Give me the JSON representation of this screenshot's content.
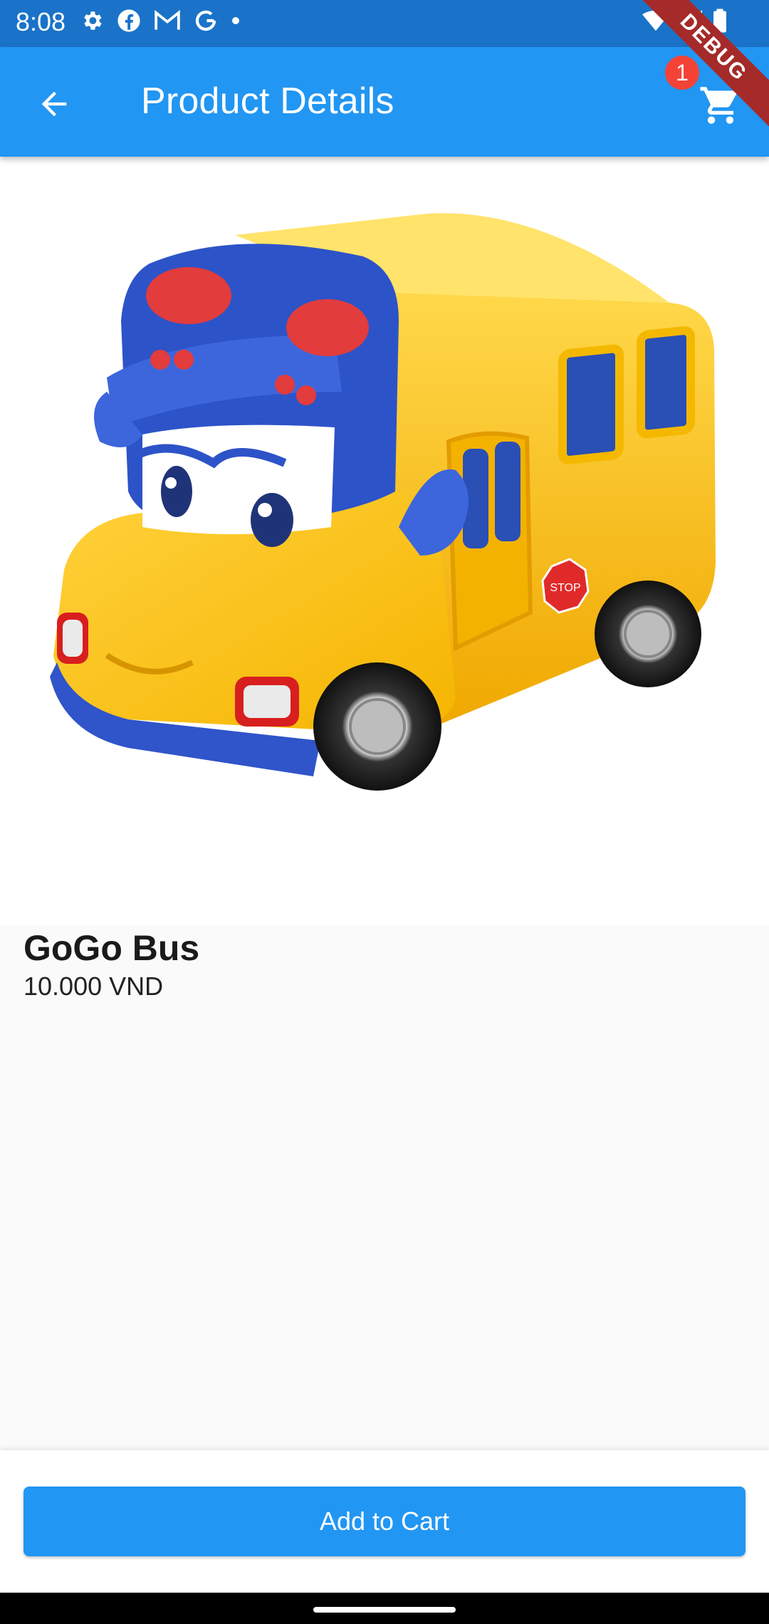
{
  "status_bar": {
    "time": "8:08",
    "left_icons": [
      "settings-icon",
      "facebook-icon",
      "gmail-icon",
      "google-icon",
      "dot-icon"
    ],
    "right_icons": [
      "wifi-icon",
      "signal-icon",
      "battery-icon"
    ]
  },
  "app_bar": {
    "title": "Product Details",
    "cart_count": "1",
    "background": "#2196f3"
  },
  "debug_banner": "DEBUG",
  "product": {
    "name": "GoGo Bus",
    "price": "10.000 VND",
    "image_icon": "toy-bus-image"
  },
  "actions": {
    "add_to_cart_label": "Add to Cart"
  }
}
